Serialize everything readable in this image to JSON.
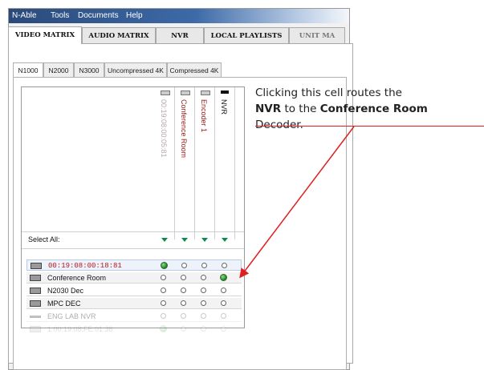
{
  "menu": {
    "items": [
      "N-Able",
      "Tools",
      "Documents",
      "Help"
    ]
  },
  "tabs": {
    "items": [
      "VIDEO MATRIX",
      "AUDIO MATRIX",
      "NVR",
      "LOCAL PLAYLISTS",
      "UNIT MA"
    ],
    "active": "VIDEO MATRIX"
  },
  "subtabs": {
    "items": [
      "N1000",
      "N2000",
      "N3000",
      "Uncompressed 4K",
      "Compressed 4K"
    ],
    "active": "N1000"
  },
  "matrix": {
    "columns": [
      "00:19:08:00:05:81",
      "Conference Room",
      "Encoder 1",
      "NVR"
    ],
    "select_all": "Select All:",
    "rows": [
      {
        "label": "00:19:08:00:18:81",
        "cells": [
          true,
          false,
          false,
          false
        ]
      },
      {
        "label": "Conference Room",
        "cells": [
          false,
          false,
          false,
          true
        ]
      },
      {
        "label": "N2030 Dec",
        "cells": [
          false,
          false,
          false,
          false
        ]
      },
      {
        "label": "MPC DEC",
        "cells": [
          false,
          false,
          false,
          false
        ]
      },
      {
        "label": "ENG LAB NVR",
        "cells": [
          false,
          false,
          false,
          false
        ]
      },
      {
        "label": "1:00:19:08:FE:01:38",
        "cells": [
          true,
          false,
          false,
          false
        ]
      }
    ]
  },
  "callout": {
    "part1": "Clicking this cell routes the",
    "bold1": "NVR",
    "part2": " to the ",
    "bold2": "Conference Room",
    "part3": "Decoder."
  },
  "colors": {
    "accent_red": "#e02020",
    "route_green": "#1f8a1f",
    "select_triangle": "#0f8a4d",
    "column_red": "#9b1c1c"
  }
}
